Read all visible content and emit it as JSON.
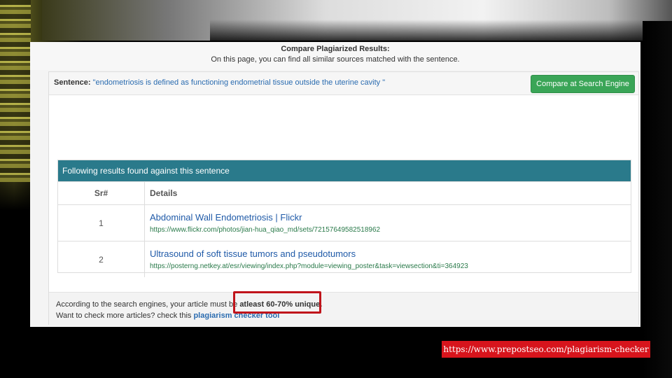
{
  "header": {
    "title": "Compare Plagiarized Results:",
    "subtitle": "On this page, you can find all similar sources matched with the sentence."
  },
  "sentence": {
    "label": "Sentence:",
    "text": "\"endometriosis is defined as functioning endometrial tissue outside the uterine cavity \""
  },
  "compare_button": {
    "label": "Compare at Search Engine"
  },
  "results": {
    "heading": "Following results found against this sentence",
    "columns": [
      "Sr#",
      "Details"
    ],
    "rows": [
      {
        "sr": "1",
        "title": "Abdominal Wall Endometriosis | Flickr",
        "url": "https://www.flickr.com/photos/jian-hua_qiao_md/sets/72157649582518962"
      },
      {
        "sr": "2",
        "title": "Ultrasound of soft tissue tumors and pseudotumors",
        "url": "https://posterng.netkey.at/esr/viewing/index.php?module=viewing_poster&task=viewsection&ti=364923"
      }
    ]
  },
  "footer": {
    "line1_prefix": "According to the search engines, your article must be",
    "line1_strong": "atleast 60-70% unique.",
    "line2_prefix": "Want to check more articles? check this",
    "line2_link": "plagiarism checker tool"
  },
  "source_url": "https://www.prepostseo.com/plagiarism-checker",
  "colors": {
    "header_bar": "#2a7a8b",
    "button": "#3aa557",
    "highlight": "#c0141b",
    "badge": "#d7141c"
  }
}
